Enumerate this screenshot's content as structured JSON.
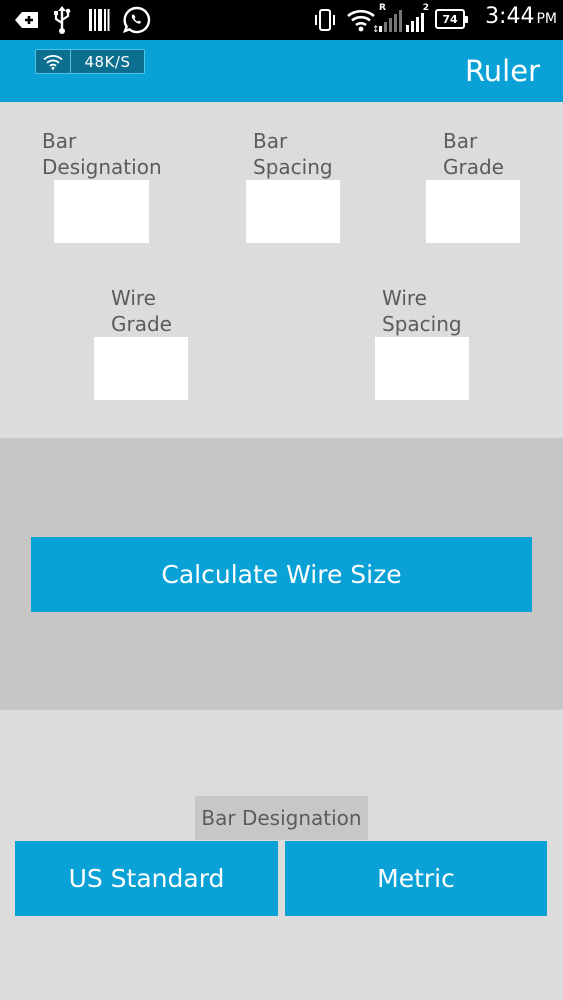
{
  "status_bar": {
    "time": "3:44",
    "ampm": "PM",
    "battery": "74",
    "network_label": "R",
    "network_num": "2"
  },
  "app_bar": {
    "speed": "48K/S",
    "title": "Ruler"
  },
  "fields": {
    "bar_designation": {
      "label": "Bar\nDesignation",
      "value": ""
    },
    "bar_spacing": {
      "label": "Bar\nSpacing",
      "value": ""
    },
    "bar_grade": {
      "label": "Bar\nGrade",
      "value": ""
    },
    "wire_grade": {
      "label": "Wire\nGrade",
      "value": ""
    },
    "wire_spacing": {
      "label": "Wire\nSpacing",
      "value": ""
    }
  },
  "calculate_button": "Calculate Wire Size",
  "designation": {
    "label": "Bar Designation",
    "options": [
      "US Standard",
      "Metric"
    ]
  },
  "colors": {
    "accent": "#0aa1d6",
    "background": "#dcdcdc",
    "band": "#c6c6c6"
  }
}
